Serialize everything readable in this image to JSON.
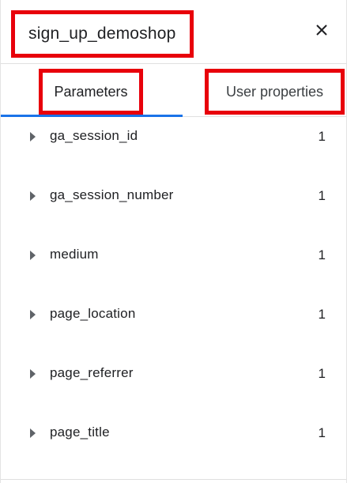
{
  "header": {
    "title": "sign_up_demoshop",
    "close_icon": "close-icon"
  },
  "tabs": [
    {
      "label": "Parameters",
      "active": true
    },
    {
      "label": "User properties",
      "active": false
    }
  ],
  "colors": {
    "highlight": "#e8000b",
    "active_tab": "#1a73e8",
    "text": "#202124",
    "divider": "#e0e0e0"
  },
  "parameters": [
    {
      "name": "ga_session_id",
      "count": "1"
    },
    {
      "name": "ga_session_number",
      "count": "1"
    },
    {
      "name": "medium",
      "count": "1"
    },
    {
      "name": "page_location",
      "count": "1"
    },
    {
      "name": "page_referrer",
      "count": "1"
    },
    {
      "name": "page_title",
      "count": "1"
    }
  ]
}
